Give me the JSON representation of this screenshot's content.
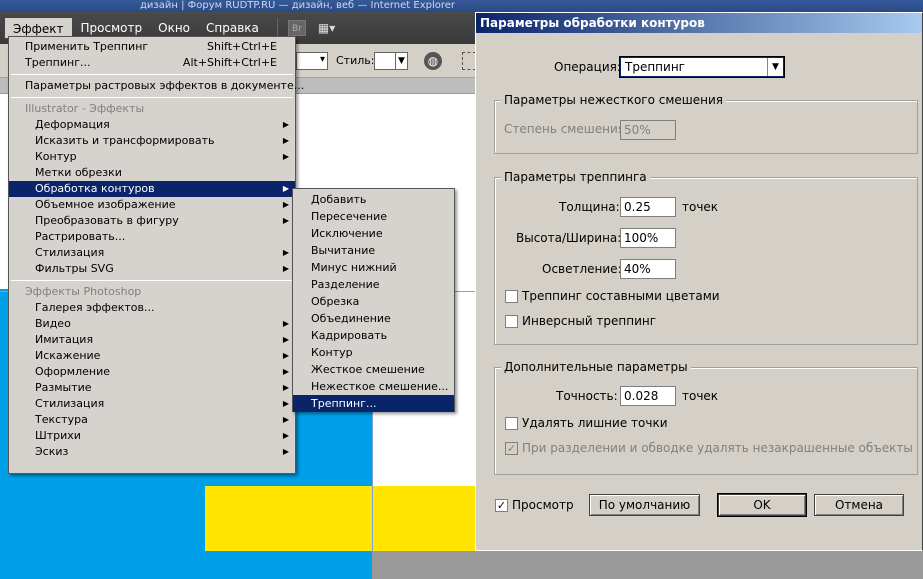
{
  "window": {
    "title_strip": "дизайн | Форум RUDTP.RU — дизайн, веб — Internet Explorer"
  },
  "menubar": {
    "items": [
      {
        "label": "Эффект",
        "active": true
      },
      {
        "label": "Просмотр"
      },
      {
        "label": "Окно"
      },
      {
        "label": "Справка"
      }
    ],
    "br_label": "Br",
    "layout_icon": "layout-grid-icon"
  },
  "optionsbar": {
    "style_label": "Стиль:"
  },
  "main_menu": {
    "apply_label": "Применить Треппинг",
    "apply_shortcut": "Shift+Ctrl+E",
    "trapping_label": "Треппинг...",
    "trapping_shortcut": "Alt+Shift+Ctrl+E",
    "raster_settings": "Параметры растровых эффектов в документе...",
    "illustrator_header": "Illustrator - Эффекты",
    "illustrator_items": [
      {
        "label": "Деформация",
        "sub": true
      },
      {
        "label": "Исказить и трансформировать",
        "sub": true
      },
      {
        "label": "Контур",
        "sub": true
      },
      {
        "label": "Метки обрезки",
        "sub": false
      },
      {
        "label": "Обработка контуров",
        "sub": true,
        "selected": true
      },
      {
        "label": "Объемное изображение",
        "sub": true
      },
      {
        "label": "Преобразовать в фигуру",
        "sub": true
      },
      {
        "label": "Растрировать...",
        "sub": false
      },
      {
        "label": "Стилизация",
        "sub": true
      },
      {
        "label": "Фильтры SVG",
        "sub": true
      }
    ],
    "photoshop_header": "Эффекты Photoshop",
    "photoshop_items": [
      {
        "label": "Галерея эффектов...",
        "sub": false
      },
      {
        "label": "Видео",
        "sub": true
      },
      {
        "label": "Имитация",
        "sub": true
      },
      {
        "label": "Искажение",
        "sub": true
      },
      {
        "label": "Оформление",
        "sub": true
      },
      {
        "label": "Размытие",
        "sub": true
      },
      {
        "label": "Стилизация",
        "sub": true
      },
      {
        "label": "Текстура",
        "sub": true
      },
      {
        "label": "Штрихи",
        "sub": true
      },
      {
        "label": "Эскиз",
        "sub": true
      }
    ]
  },
  "sub_menu": {
    "items": [
      {
        "label": "Добавить"
      },
      {
        "label": "Пересечение"
      },
      {
        "label": "Исключение"
      },
      {
        "label": "Вычитание"
      },
      {
        "label": "Минус нижний"
      },
      {
        "label": "Разделение"
      },
      {
        "label": "Обрезка"
      },
      {
        "label": "Объединение"
      },
      {
        "label": "Кадрировать"
      },
      {
        "label": "Контур"
      },
      {
        "label": "Жесткое смешение"
      },
      {
        "label": "Нежесткое смешение..."
      },
      {
        "label": "Треппинг...",
        "selected": true
      }
    ]
  },
  "dialog": {
    "title": "Параметры обработки контуров",
    "operation_label": "Операция:",
    "operation_value": "Треппинг",
    "soft_mix_group": "Параметры нежесткого смешения",
    "mix_degree_label": "Степень смешения:",
    "mix_degree_value": "50%",
    "trapping_group": "Параметры треппинга",
    "thickness_label": "Толщина:",
    "thickness_value": "0.25",
    "thickness_unit": "точек",
    "hw_label": "Высота/Ширина:",
    "hw_value": "100%",
    "tint_label": "Осветление:",
    "tint_value": "40%",
    "process_colors_label": "Треппинг составными цветами",
    "process_colors_checked": false,
    "inverse_label": "Инверсный треппинг",
    "inverse_checked": false,
    "extra_group": "Дополнительные параметры",
    "precision_label": "Точность:",
    "precision_value": "0.028",
    "precision_unit": "точек",
    "remove_points_label": "Удалять лишние точки",
    "remove_points_checked": false,
    "split_label": "При разделении и обводке удалять незакрашенные объекты",
    "split_checked": true,
    "preview_label": "Просмотр",
    "preview_checked": true,
    "default_button": "По умолчанию",
    "ok_button": "OK",
    "cancel_button": "Отмена"
  },
  "colors": {
    "selection": "#0a246a",
    "canvas_blue": "#00a0e8",
    "canvas_yellow": "#ffe500"
  }
}
